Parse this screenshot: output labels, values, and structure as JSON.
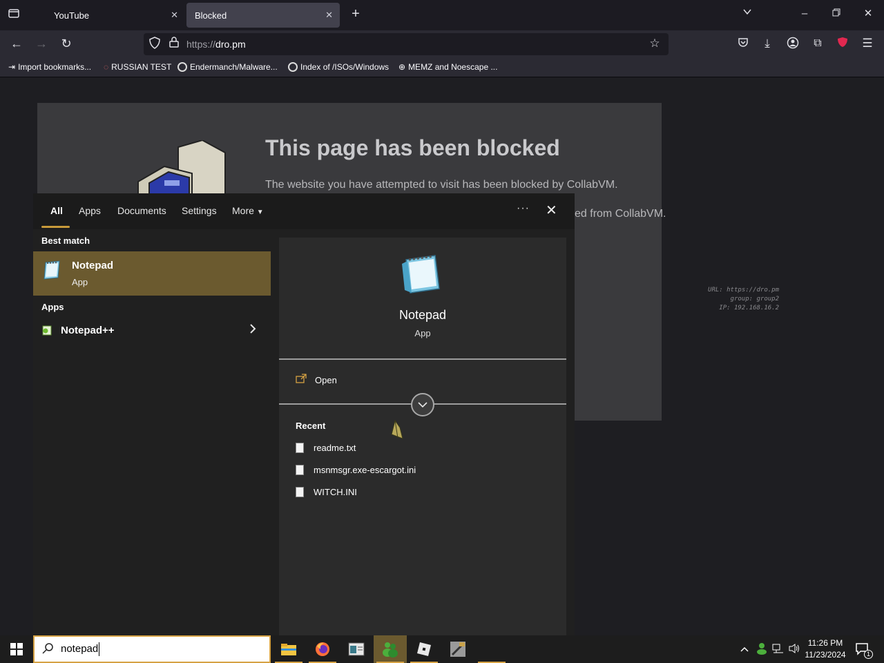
{
  "browser": {
    "tabs": [
      {
        "label": "YouTube",
        "active": false
      },
      {
        "label": "Blocked",
        "active": true
      }
    ],
    "url_protocol": "https://",
    "url_host": "dro.pm",
    "bookmarks": [
      {
        "label": "Import bookmarks...",
        "icon": "import-icon"
      },
      {
        "label": "RUSSIAN TEST",
        "icon": "search-icon"
      },
      {
        "label": "Endermanch/Malware...",
        "icon": "google-icon"
      },
      {
        "label": "Index of /ISOs/Windows",
        "icon": "google-icon"
      },
      {
        "label": "MEMZ and Noescape ...",
        "icon": "globe-icon"
      }
    ],
    "accent": "#e22850"
  },
  "blocked_page": {
    "title": "This page has been blocked",
    "text": "The website you have attempted to visit has been blocked by CollabVM.",
    "text2": "ed from CollabVM.",
    "meta_url": "URL: https://dro.pm",
    "meta_group": "group: group2",
    "meta_ip": "IP: 192.168.16.2"
  },
  "search": {
    "tabs": [
      "All",
      "Apps",
      "Documents",
      "Settings",
      "More"
    ],
    "best_match_header": "Best match",
    "best_match": {
      "name": "Notepad",
      "type": "App"
    },
    "apps_header": "Apps",
    "apps": [
      {
        "name": "Notepad++"
      }
    ],
    "detail": {
      "name": "Notepad",
      "type": "App",
      "open_label": "Open",
      "recent_header": "Recent",
      "recent": [
        "readme.txt",
        "msnmsgr.exe-escargot.ini",
        "WITCH.INI"
      ]
    },
    "query": "notepad",
    "accent": "#c89a3a"
  },
  "taskbar": {
    "time": "11:26 PM",
    "date": "11/23/2024",
    "notification_count": "1"
  }
}
